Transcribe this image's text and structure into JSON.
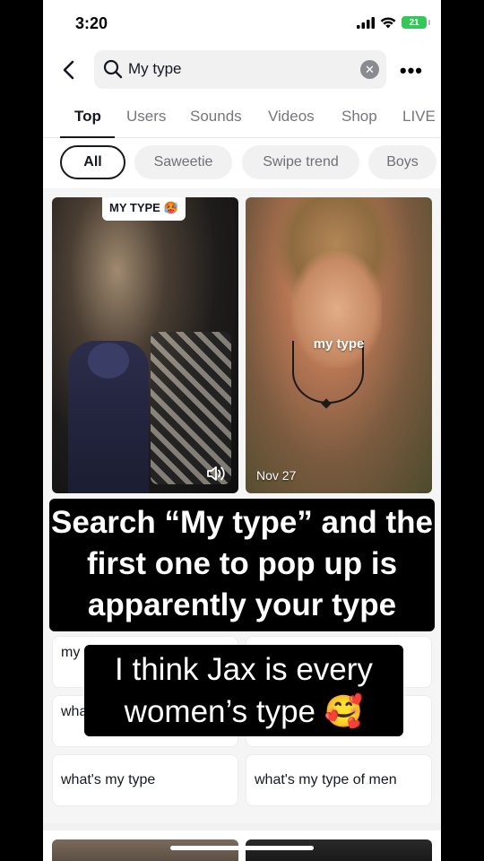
{
  "status": {
    "time": "3:20",
    "battery": "21"
  },
  "search": {
    "query": "My type"
  },
  "tabs": [
    "Top",
    "Users",
    "Sounds",
    "Videos",
    "Shop",
    "LIVE"
  ],
  "filters": [
    "All",
    "Saweetie",
    "Swipe trend",
    "Boys"
  ],
  "results": [
    {
      "badge": "MY TYPE 🥵"
    },
    {
      "overlay": "my type",
      "date": "Nov 27"
    }
  ],
  "suggestions": [
    "my",
    "",
    "wha wor",
    "",
    "what's my type",
    "what's my type of men"
  ],
  "captions": {
    "main": "Search “My type” and the first one to pop up is apparently your type",
    "sub": "I think Jax is every women’s type 🥰"
  }
}
